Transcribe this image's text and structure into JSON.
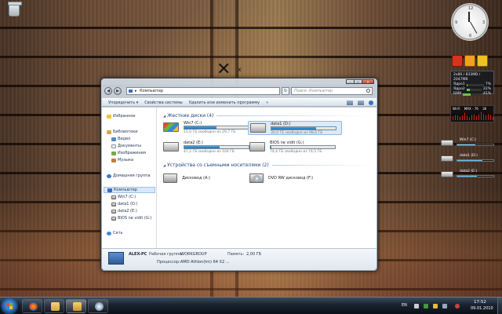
{
  "desktop": {
    "recycle_bin_label": "",
    "gadgets": {
      "meter": {
        "header": "2x86 / 833MB / 2047MB",
        "rows": [
          {
            "label": "Ядро1",
            "value": "7%",
            "fill": 0.07
          },
          {
            "label": "Ядро2",
            "value": "22%",
            "fill": 0.22
          },
          {
            "label": "RAM",
            "value": "41%",
            "fill": 0.41
          }
        ]
      },
      "wifi": {
        "label": "Wi-Fi",
        "left": "MAX - 76",
        "right": "36"
      },
      "drives": [
        {
          "label": "Win7 (C:)",
          "fill": 0.5
        },
        {
          "label": "data1 (D:)",
          "fill": 0.69
        },
        {
          "label": "data2 (E:)",
          "fill": 0.55
        }
      ]
    }
  },
  "window": {
    "address": "Компьютер",
    "address_sep": "▸",
    "search_placeholder": "Поиск: Компьютер",
    "controls": {
      "minimize": "–",
      "maximize": "▢",
      "close": "✕"
    },
    "nav": {
      "back": "◀",
      "forward": "▶",
      "refresh": "↻"
    },
    "command_bar": {
      "organize": "Упорядочить ▾",
      "system_props": "Свойства системы",
      "uninstall": "Удалить или изменить программу",
      "more": "»"
    },
    "nav_pane": {
      "favorites": "Избранное",
      "libraries": "Библиотеки",
      "video": "Видео",
      "documents": "Документы",
      "images": "Изображения",
      "music": "Музыка",
      "homegroup": "Домашняя группа",
      "computer": "Компьютер",
      "drives": [
        "Win7 (C:)",
        "data1 (D:)",
        "data2 (E:)",
        "BIOS ne vidit (G:)"
      ],
      "network": "Сеть"
    },
    "hard_disks": {
      "header": "Жесткие диски (4)",
      "items": [
        {
          "name": "Win7 (C:)",
          "free": "15,0 ГБ свободно из 29,7 ГБ",
          "fill": 0.5
        },
        {
          "name": "data1 (D:)",
          "free": "30,0 ГБ свободно из 98,6 ГБ",
          "fill": 0.7
        },
        {
          "name": "data2 (E:)",
          "free": "47,2 ГБ свободно из 104 ГБ",
          "fill": 0.55
        },
        {
          "name": "BIOS ne vidit (G:)",
          "free": "74,4 ГБ свободно из 74,5 ГБ",
          "fill": 0.0
        }
      ]
    },
    "removable": {
      "header": "Устройства со съемными носителями (2)",
      "items": [
        {
          "name": "Дисковод (A:)"
        },
        {
          "name": "DVD RW дисковод (F:)"
        }
      ]
    },
    "details": {
      "computer_name": "ALEX-PC",
      "workgroup_label": "Рабочая группа:",
      "workgroup": "WORKGROUP",
      "memory_label": "Память:",
      "memory": "2,00 ГБ",
      "cpu_label": "Процессор:",
      "cpu": "AMD Athlon(tm) 64 X2 ..."
    }
  },
  "taskbar": {
    "language": "EN",
    "time": "17:52",
    "date": "09.01.2010"
  },
  "colors": {
    "accent": "#1a6fb5",
    "taskbar": "#18222e",
    "close": "#c2402a"
  }
}
